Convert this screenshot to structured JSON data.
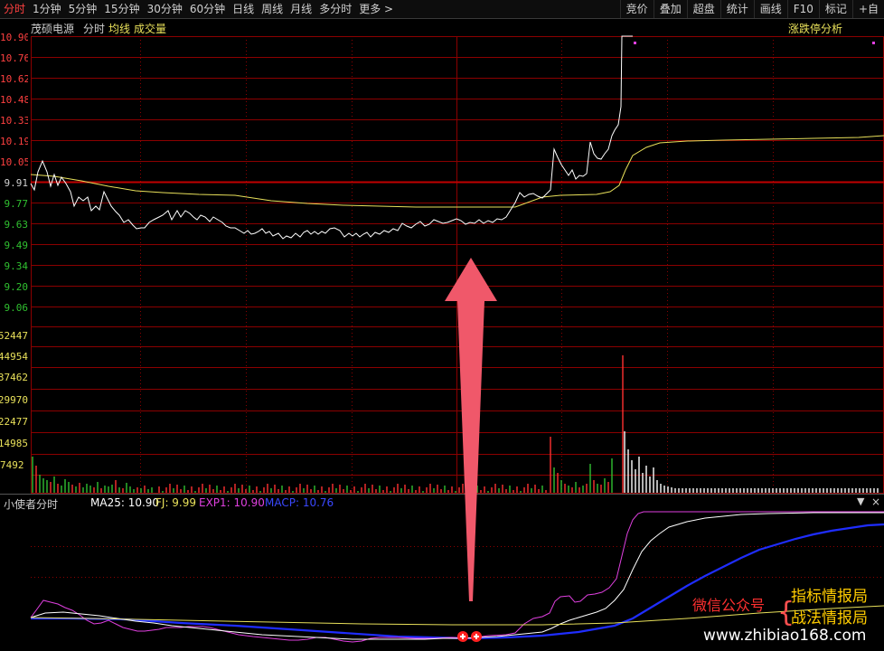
{
  "toolbar": {
    "tabs": [
      "分时",
      "1分钟",
      "5分钟",
      "15分钟",
      "30分钟",
      "60分钟",
      "日线",
      "周线",
      "月线",
      "多分时",
      "更多 >"
    ],
    "active_tab": "分时",
    "right_buttons": [
      "竞价",
      "叠加",
      "超盘",
      "统计",
      "画线",
      "F10",
      "标记",
      "+自"
    ]
  },
  "price_panel": {
    "stock_name": "茂硕电源",
    "mode_label": "分时",
    "avg_label": "均线",
    "vol_label": "成交量",
    "analysis_label": "涨跌停分析",
    "price_ticks": [
      "10.90",
      "10.76",
      "10.62",
      "10.48",
      "10.33",
      "10.19",
      "10.05",
      "9.91",
      "9.77",
      "9.63",
      "9.49",
      "9.34",
      "9.20",
      "9.06"
    ],
    "volume_ticks": [
      "52447",
      "44954",
      "37462",
      "29970",
      "22477",
      "14985",
      "7492"
    ],
    "prev_close": "9.91"
  },
  "indicator_panel": {
    "name": "小使者分时",
    "ma25": "MA25: 10.90",
    "fj": "FJ: 9.99",
    "exp1": "EXP1: 10.90",
    "macp": "MACP: 10.76"
  },
  "watermark": {
    "wechat": "微信公众号",
    "line1": "指标情报局",
    "line2": "战法情报局",
    "url": "www.zhibiao168.com"
  },
  "colors": {
    "up": "#ff3030",
    "down": "#30c030",
    "grid": "#8b0000",
    "price_line": "#ffffff",
    "avg_line": "#e8e05a",
    "exp1": "#e040e0",
    "macp": "#1f2dff",
    "arrow": "#f0586a"
  }
}
